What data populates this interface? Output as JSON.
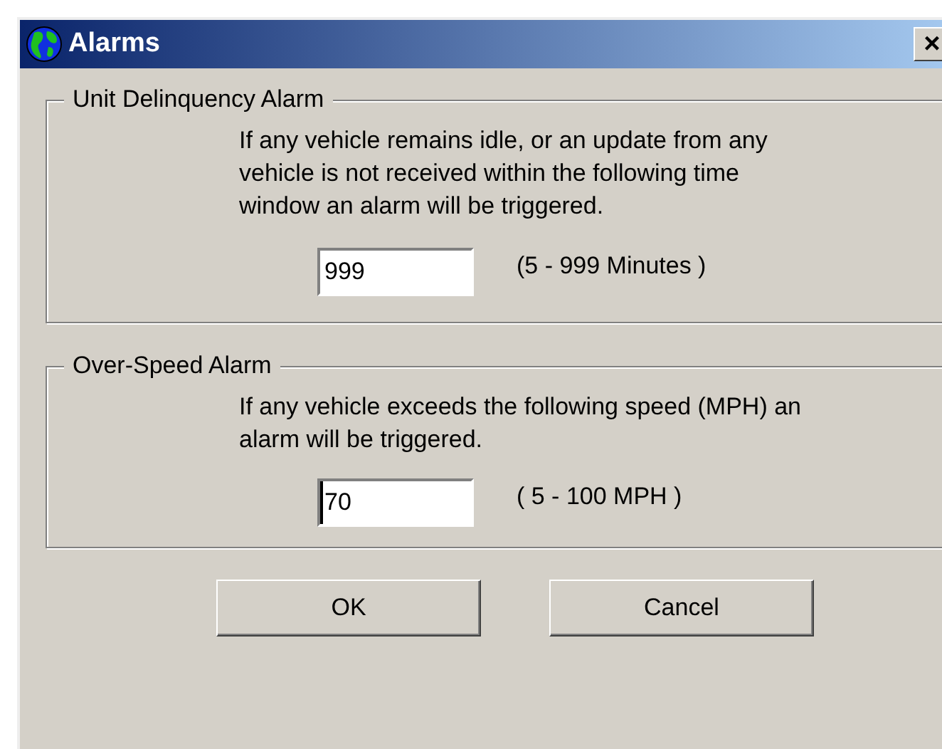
{
  "window": {
    "title": "Alarms",
    "close": "×"
  },
  "groups": [
    {
      "legend": "Unit Delinquency Alarm",
      "description": "If any vehicle remains idle, or an update from any vehicle is not received within the following time window an alarm will be triggered.",
      "value": "999",
      "range": "(5 - 999 Minutes )",
      "focused": false
    },
    {
      "legend": "Over-Speed Alarm",
      "description": "If any vehicle exceeds the following speed (MPH) an alarm will be triggered.",
      "value": "70",
      "range": "( 5 - 100 MPH )",
      "focused": true
    }
  ],
  "buttons": [
    "OK",
    "Cancel"
  ]
}
